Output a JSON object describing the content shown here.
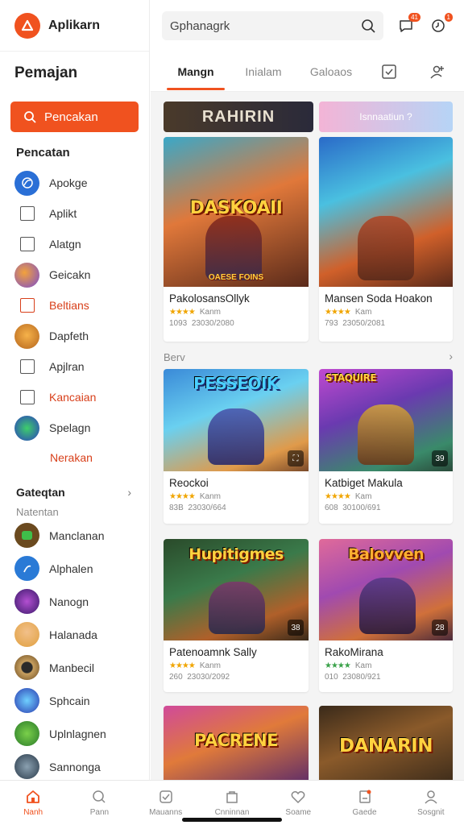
{
  "brand": {
    "name": "Aplikarn",
    "color": "#f0521f"
  },
  "sidebar": {
    "title": "Pemajan",
    "search_label": "Pencakan",
    "section_title": "Pencatan",
    "items": [
      {
        "label": "Apokge",
        "icon": "globe-icon"
      },
      {
        "label": "Aplikt",
        "icon": "checkbox-icon"
      },
      {
        "label": "Alatgn",
        "icon": "checkbox-icon"
      },
      {
        "label": "Geicakn",
        "icon": "game-avatar-icon"
      },
      {
        "label": "Beltians",
        "icon": "checkbox-icon"
      },
      {
        "label": "Dapfeth",
        "icon": "lion-avatar-icon"
      },
      {
        "label": "Apjlran",
        "icon": "checkbox-icon"
      },
      {
        "label": "Kancaian",
        "icon": "checkbox-icon"
      },
      {
        "label": "Spelagn",
        "icon": "game-avatar-icon"
      }
    ],
    "sub_link": "Nerakan",
    "category_title": "Gateqtan",
    "category_sub": "Natentan",
    "apps": [
      {
        "label": "Manclanan"
      },
      {
        "label": "Alphalen"
      },
      {
        "label": "Nanogn"
      },
      {
        "label": "Halanada"
      },
      {
        "label": "Manbecil"
      },
      {
        "label": "Sphcain"
      },
      {
        "label": "Uplnlagnen"
      },
      {
        "label": "Sannonga"
      }
    ]
  },
  "search": {
    "value": "Gphanagrk"
  },
  "notifications": {
    "chat_badge": "41",
    "alert_badge": "1"
  },
  "tabs": [
    {
      "label": "Mangn"
    },
    {
      "label": "Inialam"
    },
    {
      "label": "Galoaos"
    }
  ],
  "banners": [
    {
      "label": "RAHIRIN"
    },
    {
      "label": "Isnnaatiun ?"
    }
  ],
  "cards_row1": [
    {
      "logo": "DASKOAII",
      "sub_logo": "OAESE FOINS",
      "title": "PakolosansOllyk",
      "rating": "Kanm",
      "downloads": "1093",
      "date": "23030/2080"
    },
    {
      "logo": "",
      "sub_logo": "",
      "title": "Mansen Soda Hoakon",
      "rating": "Kam",
      "downloads": "793",
      "date": "23050/2081"
    }
  ],
  "section": {
    "label": "Berv",
    "arrow": "›"
  },
  "cards_row2": [
    {
      "logo": "PESSEOIK",
      "title": "Reockoi",
      "rating": "Kanm",
      "downloads": "83B",
      "date": "23030/664",
      "corner": "⛶"
    },
    {
      "logo": "STAQUIRE",
      "title": "Katbiget Makula",
      "rating": "Kam",
      "downloads": "608",
      "date": "30100/691",
      "corner": "39"
    }
  ],
  "cards_row3": [
    {
      "logo": "Hupitigmes",
      "title": "Patenoamnk Sally",
      "rating": "Kanm",
      "downloads": "260",
      "date": "23030/2092",
      "corner": "38"
    },
    {
      "logo": "Balovven",
      "title": "RakoMirana",
      "rating": "Kam",
      "downloads": "010",
      "date": "23080/921",
      "corner": "28"
    }
  ],
  "cards_row4": [
    {
      "logo": "PACRENE"
    },
    {
      "logo": "DANARIN"
    }
  ],
  "bottomnav": [
    {
      "label": "Nanh",
      "icon": "home-icon"
    },
    {
      "label": "Pann",
      "icon": "search-icon"
    },
    {
      "label": "Mauanns",
      "icon": "check-icon"
    },
    {
      "label": "Cnninnan",
      "icon": "bag-icon"
    },
    {
      "label": "Soame",
      "icon": "heart-icon"
    },
    {
      "label": "Gaede",
      "icon": "gift-icon"
    },
    {
      "label": "Sosgnit",
      "icon": "profile-icon"
    }
  ]
}
